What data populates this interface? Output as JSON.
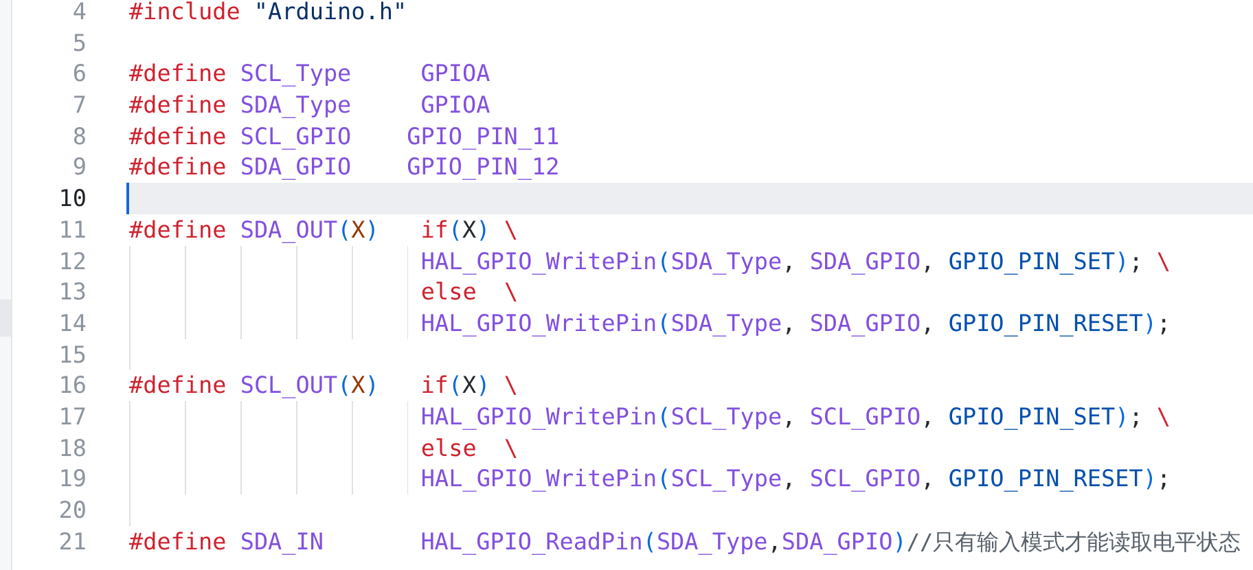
{
  "editor": {
    "lines": [
      {
        "number": "4",
        "current": false,
        "guides": false,
        "tokens": [
          {
            "kind": "preprocessor",
            "text": "#include"
          },
          {
            "kind": "string",
            "text": " \"Arduino.h\""
          }
        ]
      },
      {
        "number": "5",
        "current": false,
        "guides": false
      },
      {
        "number": "6",
        "current": false,
        "guides": false,
        "tokens": [
          {
            "kind": "preprocessor",
            "text": "#define"
          },
          {
            "kind": "macro",
            "text": " SCL_Type"
          },
          {
            "kind": "macro",
            "text": "     GPIOA"
          }
        ]
      },
      {
        "number": "7",
        "current": false,
        "guides": false,
        "tokens": [
          {
            "kind": "preprocessor",
            "text": "#define"
          },
          {
            "kind": "macro",
            "text": " SDA_Type"
          },
          {
            "kind": "macro",
            "text": "     GPIOA"
          }
        ]
      },
      {
        "number": "8",
        "current": false,
        "guides": false,
        "tokens": [
          {
            "kind": "preprocessor",
            "text": "#define"
          },
          {
            "kind": "macro",
            "text": " SCL_GPIO"
          },
          {
            "kind": "macro",
            "text": "    GPIO_PIN_11"
          }
        ]
      },
      {
        "number": "9",
        "current": false,
        "guides": false,
        "tokens": [
          {
            "kind": "preprocessor",
            "text": "#define"
          },
          {
            "kind": "macro",
            "text": " SDA_GPIO"
          },
          {
            "kind": "macro",
            "text": "    GPIO_PIN_12"
          }
        ]
      },
      {
        "number": "10",
        "current": true,
        "guides": false
      },
      {
        "number": "11",
        "current": false,
        "guides": false,
        "tokens": [
          {
            "kind": "preprocessor",
            "text": "#define"
          },
          {
            "kind": "macro",
            "text": " SDA_OUT"
          },
          {
            "kind": "paren",
            "text": "("
          },
          {
            "kind": "param",
            "text": "X"
          },
          {
            "kind": "paren",
            "text": ")"
          },
          {
            "kind": "keyword",
            "text": "   if"
          },
          {
            "kind": "paren",
            "text": "("
          },
          {
            "kind": "plain",
            "text": "X"
          },
          {
            "kind": "paren",
            "text": ")"
          },
          {
            "kind": "keyword",
            "text": " \\"
          }
        ]
      },
      {
        "number": "12",
        "current": false,
        "guides": true,
        "tokens": [
          {
            "kind": "macro",
            "text": "HAL_GPIO_WritePin"
          },
          {
            "kind": "paren",
            "text": "("
          },
          {
            "kind": "macro",
            "text": "SDA_Type"
          },
          {
            "kind": "plain",
            "text": ","
          },
          {
            "kind": "macro",
            "text": " SDA_GPIO"
          },
          {
            "kind": "plain",
            "text": ","
          },
          {
            "kind": "constant",
            "text": " GPIO_PIN_SET"
          },
          {
            "kind": "paren",
            "text": ")"
          },
          {
            "kind": "plain",
            "text": ";"
          },
          {
            "kind": "keyword",
            "text": " \\"
          }
        ]
      },
      {
        "number": "13",
        "current": false,
        "guides": true,
        "tokens": [
          {
            "kind": "keyword",
            "text": "else"
          },
          {
            "kind": "keyword",
            "text": "  \\"
          }
        ]
      },
      {
        "number": "14",
        "current": false,
        "guides": true,
        "tokens": [
          {
            "kind": "macro",
            "text": "HAL_GPIO_WritePin"
          },
          {
            "kind": "paren",
            "text": "("
          },
          {
            "kind": "macro",
            "text": "SDA_Type"
          },
          {
            "kind": "plain",
            "text": ","
          },
          {
            "kind": "macro",
            "text": " SDA_GPIO"
          },
          {
            "kind": "plain",
            "text": ","
          },
          {
            "kind": "constant",
            "text": " GPIO_PIN_RESET"
          },
          {
            "kind": "paren",
            "text": ")"
          },
          {
            "kind": "plain",
            "text": ";"
          }
        ]
      },
      {
        "number": "15",
        "current": false,
        "guides": true
      },
      {
        "number": "16",
        "current": false,
        "guides": false,
        "tokens": [
          {
            "kind": "preprocessor",
            "text": "#define"
          },
          {
            "kind": "macro",
            "text": " SCL_OUT"
          },
          {
            "kind": "paren",
            "text": "("
          },
          {
            "kind": "param",
            "text": "X"
          },
          {
            "kind": "paren",
            "text": ")"
          },
          {
            "kind": "keyword",
            "text": "   if"
          },
          {
            "kind": "paren",
            "text": "("
          },
          {
            "kind": "plain",
            "text": "X"
          },
          {
            "kind": "paren",
            "text": ")"
          },
          {
            "kind": "keyword",
            "text": " \\"
          }
        ]
      },
      {
        "number": "17",
        "current": false,
        "guides": true,
        "tokens": [
          {
            "kind": "macro",
            "text": "HAL_GPIO_WritePin"
          },
          {
            "kind": "paren",
            "text": "("
          },
          {
            "kind": "macro",
            "text": "SCL_Type"
          },
          {
            "kind": "plain",
            "text": ","
          },
          {
            "kind": "macro",
            "text": " SCL_GPIO"
          },
          {
            "kind": "plain",
            "text": ","
          },
          {
            "kind": "constant",
            "text": " GPIO_PIN_SET"
          },
          {
            "kind": "paren",
            "text": ")"
          },
          {
            "kind": "plain",
            "text": ";"
          },
          {
            "kind": "keyword",
            "text": " \\"
          }
        ]
      },
      {
        "number": "18",
        "current": false,
        "guides": true,
        "tokens": [
          {
            "kind": "keyword",
            "text": "else"
          },
          {
            "kind": "keyword",
            "text": "  \\"
          }
        ]
      },
      {
        "number": "19",
        "current": false,
        "guides": true,
        "tokens": [
          {
            "kind": "macro",
            "text": "HAL_GPIO_WritePin"
          },
          {
            "kind": "paren",
            "text": "("
          },
          {
            "kind": "macro",
            "text": "SCL_Type"
          },
          {
            "kind": "plain",
            "text": ","
          },
          {
            "kind": "macro",
            "text": " SCL_GPIO"
          },
          {
            "kind": "plain",
            "text": ","
          },
          {
            "kind": "constant",
            "text": " GPIO_PIN_RESET"
          },
          {
            "kind": "paren",
            "text": ")"
          },
          {
            "kind": "plain",
            "text": ";"
          }
        ]
      },
      {
        "number": "20",
        "current": false,
        "guides": true
      },
      {
        "number": "21",
        "current": false,
        "guides": false,
        "tokens": [
          {
            "kind": "preprocessor",
            "text": "#define"
          },
          {
            "kind": "macro",
            "text": " SDA_IN"
          },
          {
            "kind": "macro",
            "text": "       HAL_GPIO_ReadPin"
          },
          {
            "kind": "paren",
            "text": "("
          },
          {
            "kind": "macro",
            "text": "SDA_Type"
          },
          {
            "kind": "plain",
            "text": ","
          },
          {
            "kind": "macro",
            "text": "SDA_GPIO"
          },
          {
            "kind": "paren",
            "text": ")"
          },
          {
            "kind": "comment",
            "text": "//只有输入模式才能读取电平状态"
          }
        ]
      }
    ]
  }
}
